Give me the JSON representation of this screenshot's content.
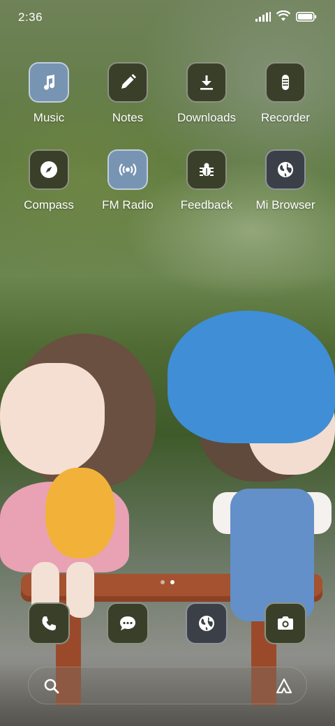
{
  "status_bar": {
    "time": "2:36",
    "icons": [
      "signal-icon",
      "wifi-icon",
      "battery-icon"
    ]
  },
  "home_grid": {
    "apps": [
      {
        "label": "Music",
        "icon": "music-note-icon",
        "style": "blue"
      },
      {
        "label": "Notes",
        "icon": "pencil-icon",
        "style": "dark"
      },
      {
        "label": "Downloads",
        "icon": "download-icon",
        "style": "dark"
      },
      {
        "label": "Recorder",
        "icon": "microphone-icon",
        "style": "dark"
      },
      {
        "label": "Compass",
        "icon": "compass-icon",
        "style": "dark"
      },
      {
        "label": "FM Radio",
        "icon": "radio-signal-icon",
        "style": "blue"
      },
      {
        "label": "Feedback",
        "icon": "bug-icon",
        "style": "dark"
      },
      {
        "label": "Mi Browser",
        "icon": "globe-icon",
        "style": "slate"
      }
    ]
  },
  "page_indicator": {
    "pages": 2,
    "active_index": 1
  },
  "dock": {
    "apps": [
      {
        "icon": "phone-icon"
      },
      {
        "icon": "chat-bubble-icon"
      },
      {
        "icon": "globe-icon"
      },
      {
        "icon": "camera-icon"
      }
    ]
  },
  "search_bar": {
    "left_icon": "search-icon",
    "right_icon": "assistant-a-icon"
  },
  "colors": {
    "icon_dark": "#3a3f2a",
    "icon_blue": "#7894b3",
    "icon_slate": "#3b4048",
    "text": "#ffffff"
  }
}
